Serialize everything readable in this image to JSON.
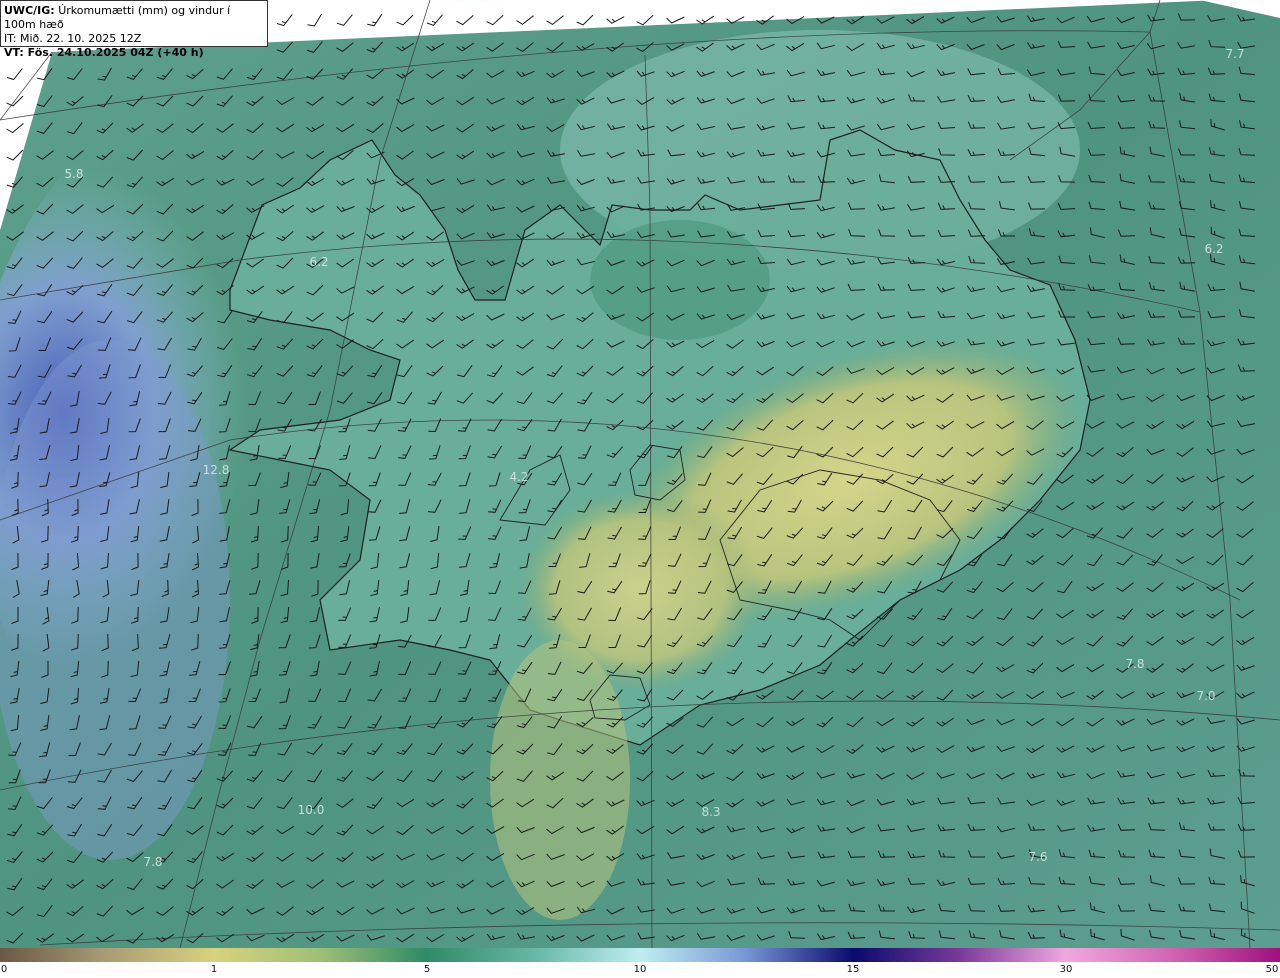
{
  "header": {
    "model": "UWC/IG:",
    "product": "Úrkomumætti (mm) og vindur í 100m hæð",
    "init_time": "IT: Mið. 22. 10. 2025 12Z",
    "valid_time": "VT: Fös. 24.10.2025 04Z (+40 h)"
  },
  "map_labels": {
    "l1": "7.7",
    "l2": "5.8",
    "l3": "6.2",
    "l4": "6.2",
    "l5": "12.8",
    "l6": "4.2",
    "l7": "7.8",
    "l8": "7.0",
    "l9": "10.0",
    "l10": "8.3",
    "l11": "7.6",
    "l12": "7.8"
  },
  "colorbar": {
    "ticks": [
      "0",
      "1",
      "5",
      "10",
      "15",
      "30",
      "50"
    ],
    "colors": [
      "#6b5844",
      "#d8d27e",
      "#2f8a66",
      "#bfeef0",
      "#0a0a6e",
      "#f0a8e0",
      "#a0107e"
    ]
  }
}
